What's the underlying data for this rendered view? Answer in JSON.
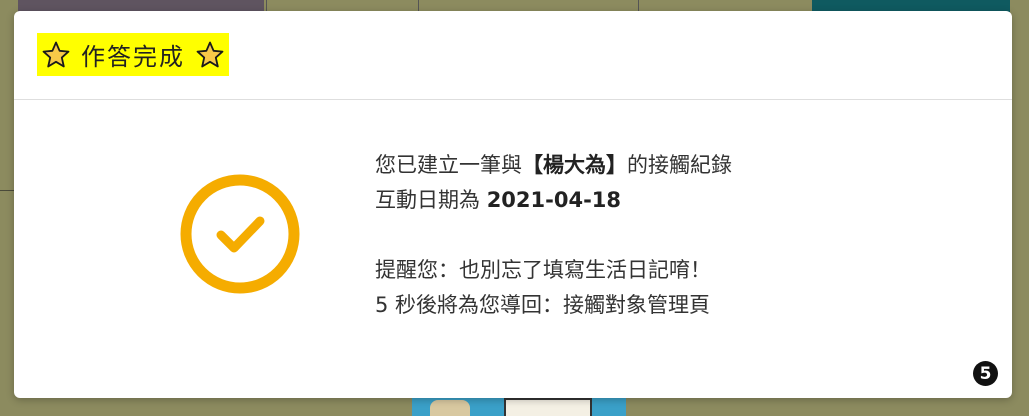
{
  "modal": {
    "title": "作答完成",
    "icons": {
      "title_left": "star-icon",
      "title_right": "star-icon",
      "status": "check-circle-icon"
    },
    "message": {
      "line1_prefix": "您已建立一筆與",
      "bracket_open": "【",
      "contact_name": "楊大為",
      "bracket_close": "】",
      "line1_suffix": "的接觸紀錄",
      "line2_prefix": "互動日期為",
      "interaction_date": "2021-04-18",
      "line3": "提醒您：也別忘了填寫生活日記唷！",
      "line4": "5 秒後將為您導回：接觸對象管理頁"
    },
    "countdown": "5"
  },
  "colors": {
    "highlight": "#ffff00",
    "success_ring": "#f5ac00",
    "overlay": "#8c8b5f"
  }
}
